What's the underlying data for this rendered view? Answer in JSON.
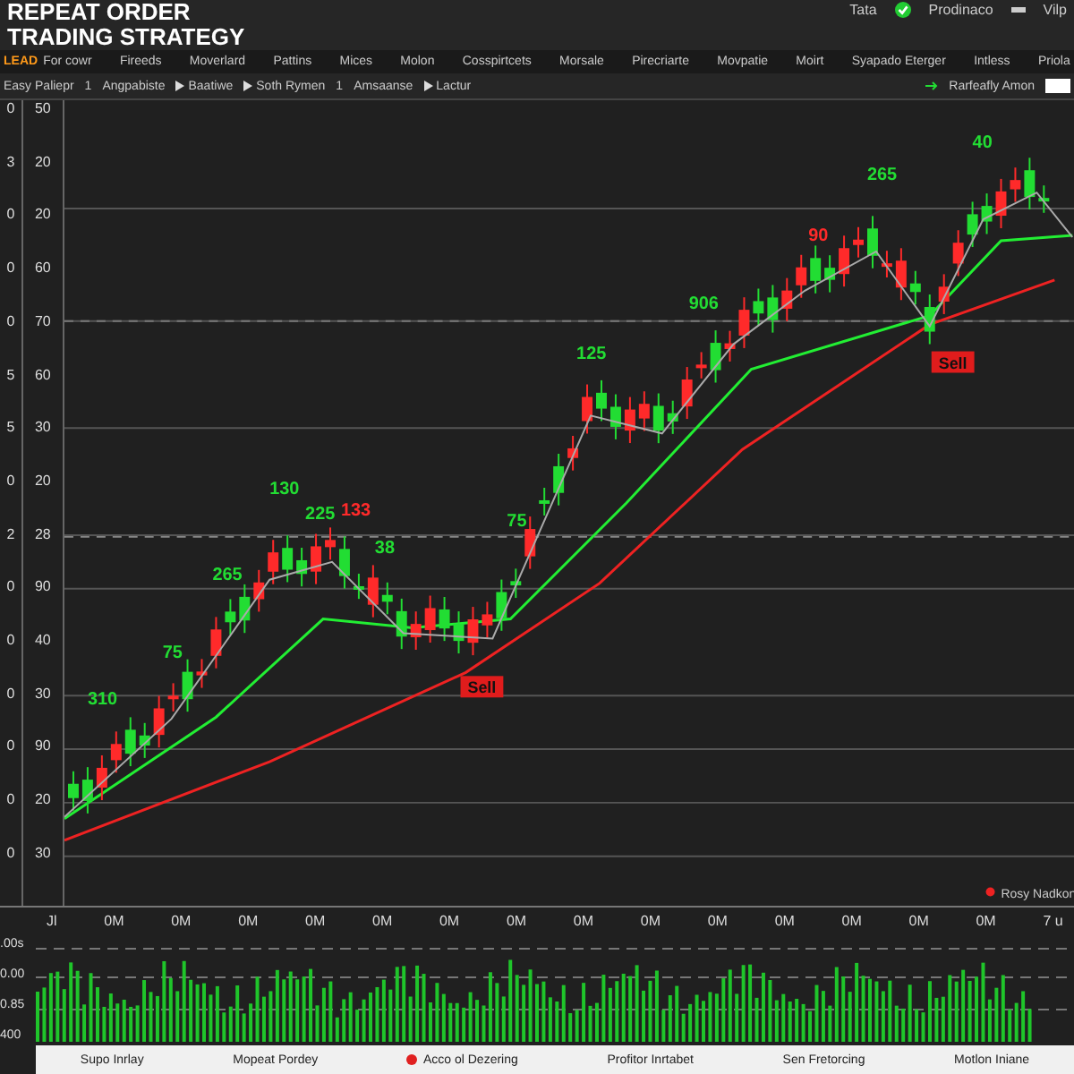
{
  "title": [
    "REPEAT ORDER",
    "TRADING STRATEGY"
  ],
  "header_links": [
    "Tata",
    "Prodinaco",
    "Vilp"
  ],
  "menu": {
    "badge": "LEAD",
    "items": [
      "For cowr",
      "Fireeds",
      "Moverlard",
      "Pattins",
      "Mices",
      "Molon",
      "Cosspirtcets",
      "Morsale",
      "Pirecriarte",
      "Movpatie",
      "Moirt",
      "Syapado Eterger",
      "Intless",
      "Priola"
    ]
  },
  "toolbar": [
    {
      "kind": "text",
      "label": "Easy Paliepr"
    },
    {
      "kind": "count",
      "label": "1"
    },
    {
      "kind": "text",
      "label": "Angpabiste"
    },
    {
      "kind": "play",
      "label": "Baatiwe"
    },
    {
      "kind": "play",
      "label": "Soth Rymen"
    },
    {
      "kind": "count",
      "label": "1"
    },
    {
      "kind": "text",
      "label": "Amsaanse"
    },
    {
      "kind": "play",
      "label": "Lactur"
    }
  ],
  "toolbar_right": "Rarfeafly Amon",
  "axis": {
    "outer": [
      "0",
      "3",
      "0",
      "0",
      "0",
      "5",
      "5",
      "0",
      "2",
      "0",
      "0",
      "0",
      "0",
      "0",
      "0"
    ],
    "inner": [
      "50",
      "20",
      "20",
      "60",
      "70",
      "60",
      "30",
      "20",
      "28",
      "90",
      "40",
      "30",
      "90",
      "20",
      "30"
    ]
  },
  "annotations": [
    {
      "label": "310",
      "color": "#22dd33"
    },
    {
      "label": "75",
      "color": "#22dd33"
    },
    {
      "label": "265",
      "color": "#22dd33"
    },
    {
      "label": "130",
      "color": "#22dd33"
    },
    {
      "label": "225",
      "color": "#22dd33"
    },
    {
      "label": "133",
      "color": "#ff2a2a"
    },
    {
      "label": "38",
      "color": "#22dd33"
    },
    {
      "label": "75",
      "color": "#22dd33"
    },
    {
      "label": "125",
      "color": "#22dd33"
    },
    {
      "label": "906",
      "color": "#22dd33"
    },
    {
      "label": "90",
      "color": "#ff2a2a"
    },
    {
      "label": "265",
      "color": "#22dd33"
    },
    {
      "label": "40",
      "color": "#22dd33"
    }
  ],
  "signals": [
    "Sell",
    "Sell"
  ],
  "legend": "Rosy Nadkon",
  "x_labels": [
    "Jl",
    "0M",
    "0M",
    "0M",
    "0M",
    "0M",
    "0M",
    "0M",
    "0M",
    "0M",
    "0M",
    "0M",
    "0M",
    "0M",
    "0M",
    "7 u"
  ],
  "volume_axis": [
    ".00s",
    "0.00",
    "0.85",
    "400"
  ],
  "footer": [
    {
      "label": "Supo Inrlay",
      "dot": false
    },
    {
      "label": "Mopeat Pordey",
      "dot": false
    },
    {
      "label": "Acco ol Dezering",
      "dot": true
    },
    {
      "label": "Profitor Inrtabet",
      "dot": false
    },
    {
      "label": "Sen Fretorcing",
      "dot": false
    },
    {
      "label": "Motlon Iniane",
      "dot": false
    }
  ]
}
